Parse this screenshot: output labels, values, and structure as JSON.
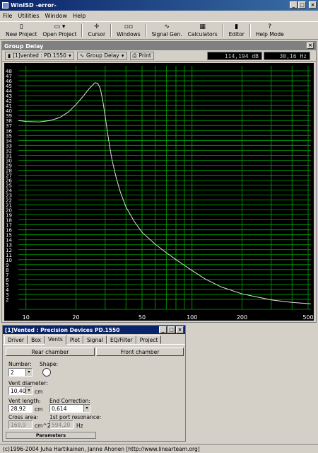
{
  "window": {
    "title": "WinISD -error-"
  },
  "menu": [
    "File",
    "Utilities",
    "Window",
    "Help"
  ],
  "toolbar": {
    "new_project": "New Project",
    "open_project": "Open Project",
    "cursor": "Cursor",
    "windows": "Windows",
    "signal_gen": "Signal Gen.",
    "calculators": "Calculators",
    "editor": "Editor",
    "help_mode": "Help Mode"
  },
  "graph": {
    "title": "Group Delay",
    "project_select": "[1]vented : PD.1550",
    "graph_type": "Group Delay",
    "print": "Print",
    "readout_db": "114,194 dB",
    "readout_hz": "30,16 Hz"
  },
  "chart_data": {
    "type": "line",
    "title": "",
    "xlabel": "",
    "ylabel": "",
    "xscale": "log",
    "xlim": [
      9,
      520
    ],
    "ylim": [
      0,
      49
    ],
    "x_ticks": [
      10,
      20,
      50,
      100,
      200,
      500
    ],
    "y_ticks": [
      2,
      3,
      4,
      5,
      6,
      7,
      8,
      9,
      10,
      11,
      12,
      13,
      14,
      15,
      16,
      17,
      18,
      19,
      20,
      21,
      22,
      23,
      24,
      25,
      26,
      27,
      28,
      29,
      30,
      31,
      32,
      33,
      34,
      35,
      36,
      37,
      38,
      39,
      40,
      41,
      42,
      43,
      44,
      45,
      46,
      47,
      48
    ],
    "grid": true,
    "series": [
      {
        "x": [
          9,
          10,
          12,
          14,
          16,
          18,
          20,
          22,
          24,
          26,
          27,
          28,
          29,
          30,
          31,
          32,
          33,
          35,
          37,
          40,
          45,
          50,
          60,
          70,
          80,
          100,
          120,
          150,
          200,
          300,
          400,
          520
        ],
        "y": [
          38,
          37.8,
          37.7,
          38,
          38.6,
          39.7,
          41.2,
          42.8,
          44.4,
          45.6,
          45.5,
          44.5,
          42.0,
          38.8,
          35.5,
          32.5,
          30.0,
          26.4,
          23.6,
          20.6,
          17.6,
          15.5,
          13.1,
          11.4,
          10.0,
          7.8,
          6.1,
          4.5,
          3.1,
          1.9,
          1.4,
          1.1
        ]
      }
    ],
    "colors": {
      "line": "#e0e0e0",
      "grid": "#00aa00",
      "background": "#000000",
      "labels": "#ffffff"
    }
  },
  "params": {
    "title": "[1]Vented : Precision Devices PD.1550",
    "tabs": [
      "Driver",
      "Box",
      "Vents",
      "Plot",
      "Signal",
      "EQ/Filter",
      "Project"
    ],
    "active_tab": "Vents",
    "rear_chamber": "Rear chamber",
    "front_chamber": "Front chamber",
    "number_label": "Number:",
    "number_value": "2",
    "shape_label": "Shape:",
    "vent_diameter_label": "Vent diameter:",
    "vent_diameter_value": "10,40",
    "vent_diameter_unit": "cm",
    "vent_length_label": "Vent length:",
    "vent_length_value": "28,92",
    "vent_length_unit": "cm",
    "end_correction_label": "End Correction:",
    "end_correction_value": "0,614",
    "cross_area_label": "Cross area:",
    "cross_area_value": "169,9",
    "cross_area_unit": "cm^2",
    "port_res_label": "1st port resonance:",
    "port_res_value": "594,20",
    "port_res_unit": "Hz",
    "bottom_tab": "Parameters"
  },
  "statusbar": {
    "text": "(c)1996-2004 Juha Hartikainen, Janne Ahonen [http://www.linearteam.org]"
  }
}
